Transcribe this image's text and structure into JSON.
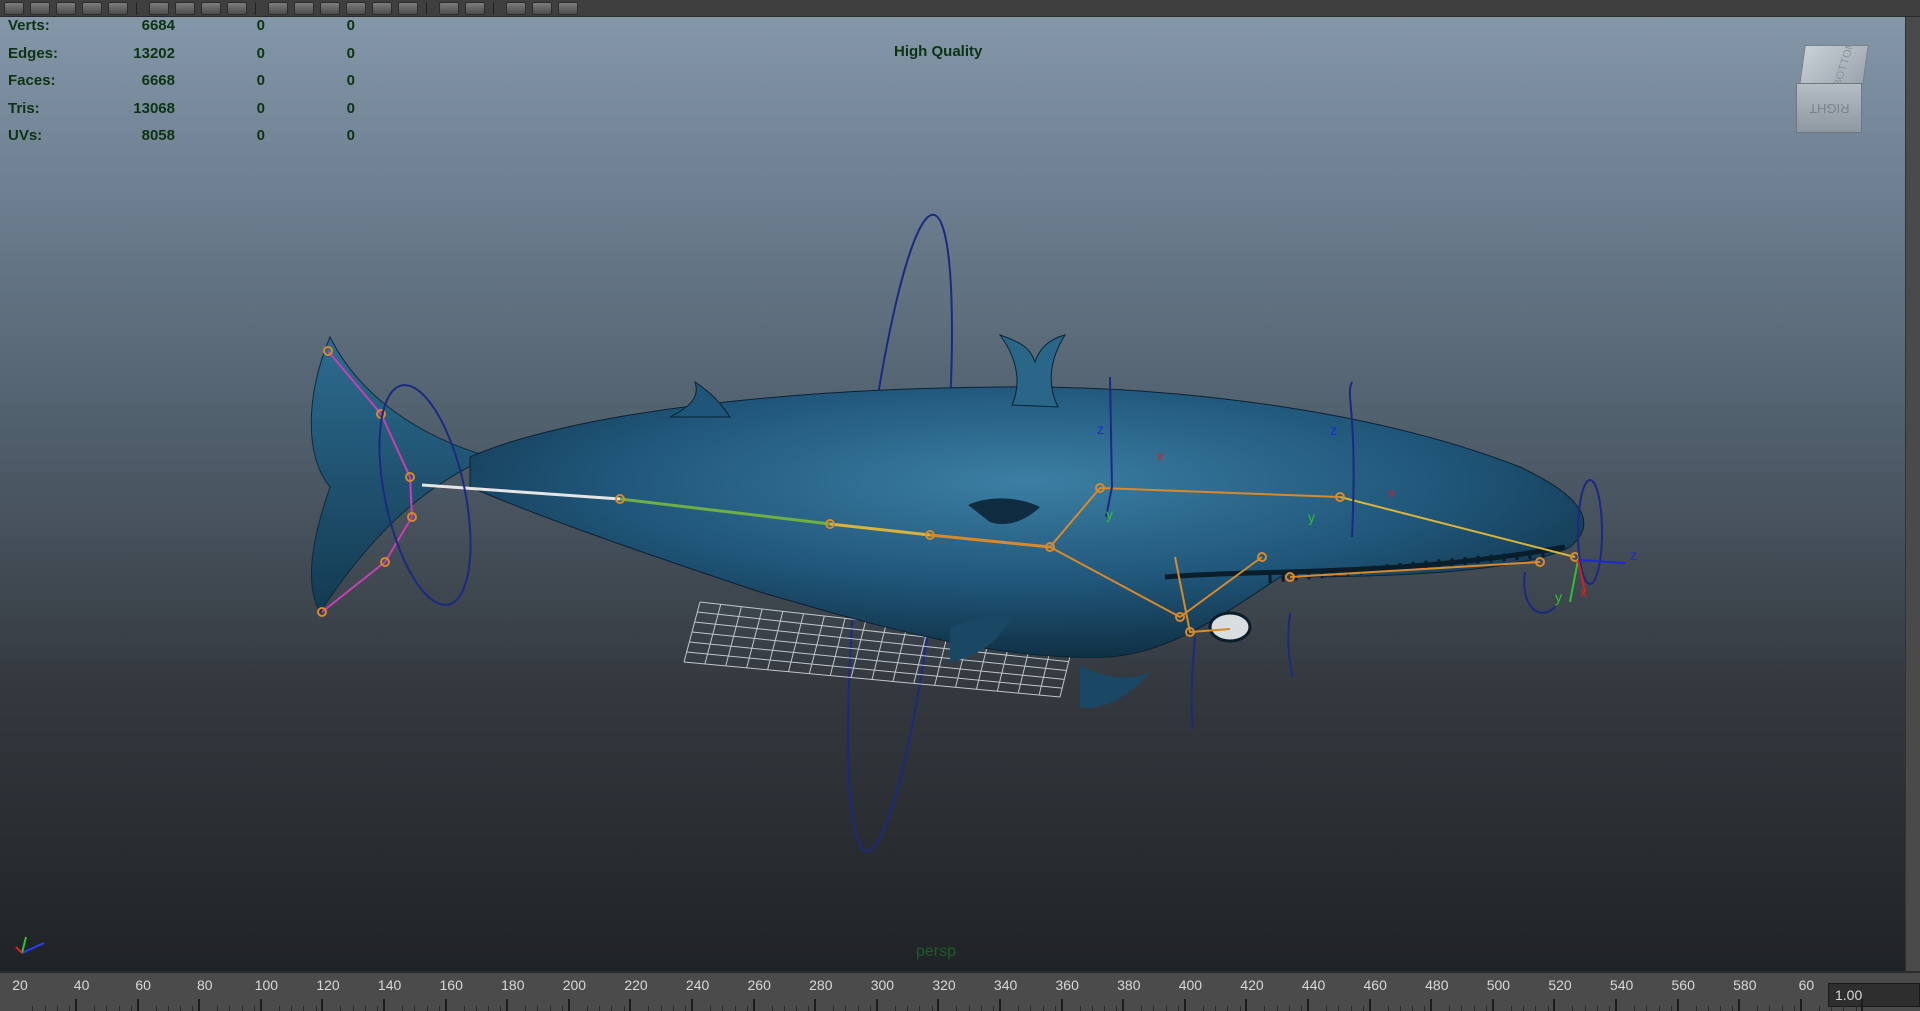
{
  "toolbar": {
    "icons": [
      "select-icon",
      "lasso-icon",
      "render-icon",
      "ipr-icon",
      "snapshot-icon",
      "hypershade-icon",
      "grid-icon",
      "film-gate-icon",
      "resolution-gate-icon",
      "safe-action-icon",
      "wireframe-icon",
      "smooth-shade-icon",
      "textured-icon",
      "lighting-icon",
      "shadows-icon",
      "xray-icon",
      "isolate-icon",
      "camera-icon",
      "display-icon",
      "tools-icon"
    ]
  },
  "hud": {
    "rows": [
      {
        "label": "Verts:",
        "v1": "6684",
        "v2": "0",
        "v3": "0"
      },
      {
        "label": "Edges:",
        "v1": "13202",
        "v2": "0",
        "v3": "0"
      },
      {
        "label": "Faces:",
        "v1": "6668",
        "v2": "0",
        "v3": "0"
      },
      {
        "label": "Tris:",
        "v1": "13068",
        "v2": "0",
        "v3": "0"
      },
      {
        "label": "UVs:",
        "v1": "8058",
        "v2": "0",
        "v3": "0"
      }
    ]
  },
  "viewport": {
    "quality_label": "High Quality",
    "camera_label": "persp",
    "viewcube": {
      "top": "BOTTOM",
      "front": "RIGHT"
    }
  },
  "axis_labels": {
    "z": "z",
    "y": "y",
    "x": "x"
  },
  "timeline": {
    "ticks": [
      "20",
      "40",
      "60",
      "80",
      "100",
      "120",
      "140",
      "160",
      "180",
      "200",
      "220",
      "240",
      "260",
      "280",
      "300",
      "320",
      "340",
      "360",
      "380",
      "400",
      "420",
      "440",
      "460",
      "480",
      "500",
      "520",
      "540",
      "560",
      "580",
      "60"
    ],
    "current_value": "1.00"
  },
  "colors": {
    "hud_text": "#0d3312",
    "body": "#1e4f6e",
    "joint_orange": "#d9892a",
    "joint_magenta": "#c83fb4",
    "control_blue": "#1b2a80"
  }
}
